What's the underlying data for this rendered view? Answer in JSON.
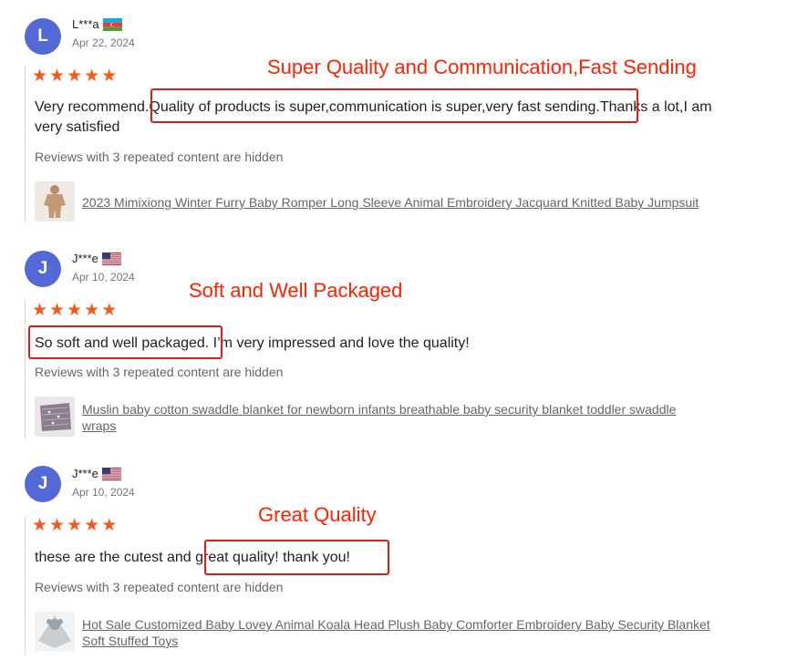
{
  "reviews": [
    {
      "avatar_letter": "L",
      "username": "L***a",
      "flag": "azerbaijan-flag",
      "date": "Apr 22, 2024",
      "stars": 5,
      "text_line1": "Very recommend.Quality of products is super,communication is super,very fast sending.Thanks a lot,I am",
      "text_line2": "very satisfied",
      "hidden_note": "Reviews with 3 repeated content are hidden",
      "product_thumb": "baby-romper-thumbnail",
      "product_line1": "2023 Mimixiong Winter Furry Baby Romper Long Sleeve Animal Embroidery Jacquard Knitted Baby Jumpsuit",
      "product_line2": "",
      "callout": "Super Quality and Communication,Fast Sending"
    },
    {
      "avatar_letter": "J",
      "username": "J***e",
      "flag": "usa-flag",
      "date": "Apr 10, 2024",
      "stars": 5,
      "text_line1": "So soft and well packaged. I’m very impressed and love the quality!",
      "text_line2": "",
      "hidden_note": "Reviews with 3 repeated content are hidden",
      "product_thumb": "swaddle-blanket-thumbnail",
      "product_line1": "Muslin baby cotton swaddle blanket for newborn infants breathable baby security blanket toddler swaddle",
      "product_line2": "wraps",
      "callout": "Soft and Well Packaged"
    },
    {
      "avatar_letter": "J",
      "username": "J***e",
      "flag": "usa-flag",
      "date": "Apr 10, 2024",
      "stars": 5,
      "text_line1": "these are the cutest and great quality! thank you!",
      "text_line2": "",
      "hidden_note": "Reviews with 3 repeated content are hidden",
      "product_thumb": "koala-lovey-thumbnail",
      "product_line1": "Hot Sale Customized Baby Lovey Animal Koala Head Plush Baby Comforter Embroidery Baby Security Blanket",
      "product_line2": "Soft Stuffed Toys",
      "callout": "Great Quality"
    }
  ],
  "colors": {
    "avatar": "#5369d6",
    "star": "#f35b1b",
    "callout": "#ff2200",
    "highlight_box": "#e01b1b"
  }
}
